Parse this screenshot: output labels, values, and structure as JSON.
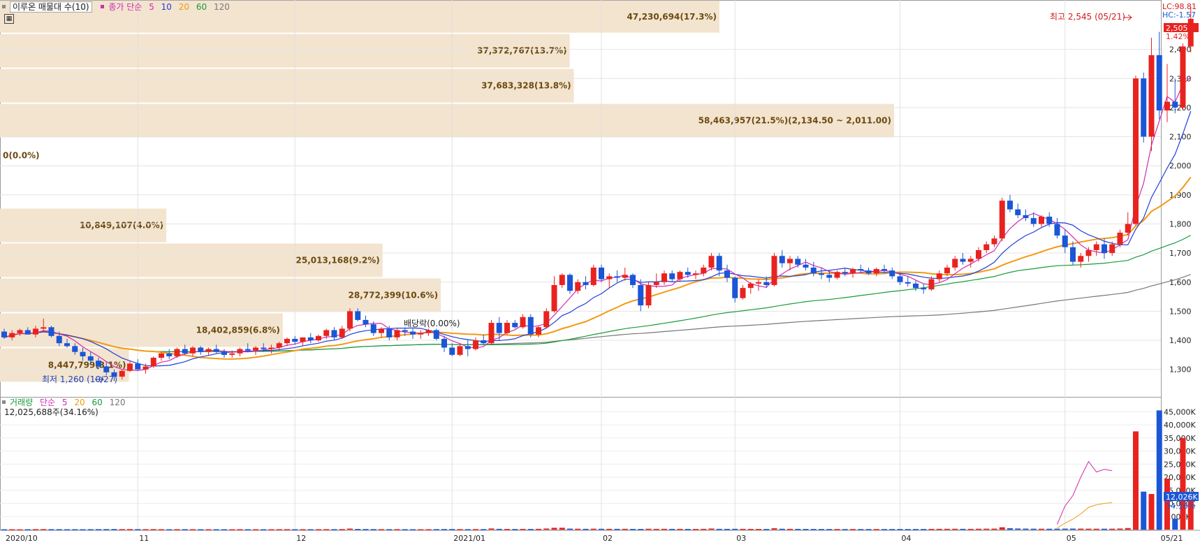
{
  "window": {
    "title": "이루온 매물대 수(10)"
  },
  "indicators": {
    "price": [
      {
        "label": "종가 단순",
        "color": "#d12bb0"
      },
      {
        "label": "5",
        "color": "#d12bb0"
      },
      {
        "label": "10",
        "color": "#1f3fd6"
      },
      {
        "label": "20",
        "color": "#f29a12"
      },
      {
        "label": "60",
        "color": "#1a9a3a"
      },
      {
        "label": "120",
        "color": "#777777"
      }
    ],
    "volume": [
      {
        "label": "거래량",
        "color": "#1a9a3a"
      },
      {
        "label": "단순",
        "color": "#d12bb0"
      },
      {
        "label": "5",
        "color": "#d12bb0"
      },
      {
        "label": "20",
        "color": "#f29a12"
      },
      {
        "label": "60",
        "color": "#1a9a3a"
      },
      {
        "label": "120",
        "color": "#777777"
      }
    ],
    "volume_readout": "12,025,688주(34.16%)"
  },
  "colors": {
    "up": "#e8231f",
    "down": "#1a56d6",
    "band": "#f3e4cf",
    "band_text": "#6b4a12",
    "ma5": "#d12bb0",
    "ma10": "#1f3fd6",
    "ma20": "#f29a12",
    "ma60": "#1a9a3a",
    "ma120": "#777777"
  },
  "side_readout": {
    "lc": "LC:98.81",
    "hc": "HC:-1.57",
    "current_price": "2,505",
    "current_pct": "1.42%",
    "current_volume": "12,026K",
    "volume_pct": "34.16%"
  },
  "annotations": {
    "high": "최고 2,545 (05/21)",
    "low": "최저 1,260 (10/27)",
    "dividend": "배당락(0.00%)"
  },
  "chart_data": {
    "type": "candlestick",
    "price_axis": {
      "min": 1220,
      "max": 2560,
      "ticks": [
        1300,
        1400,
        1500,
        1600,
        1700,
        1800,
        1900,
        2000,
        2100,
        2200,
        2300,
        2400
      ],
      "tick_labels": [
        "1,300",
        "1,400",
        "1,500",
        "1,600",
        "1,700",
        "1,800",
        "1,900",
        "2,000",
        "2,100",
        "2,200",
        "2,300",
        "2,400"
      ]
    },
    "volume_axis": {
      "max": 48000,
      "ticks": [
        5000,
        10000,
        15000,
        20000,
        25000,
        30000,
        35000,
        40000,
        45000
      ],
      "tick_labels": [
        "5,000K",
        "10,000K",
        "15,000K",
        "20,000K",
        "25,000K",
        "30,000K",
        "35,000K",
        "40,000K",
        "45,000K"
      ]
    },
    "x_labels": [
      {
        "label": "2020/10",
        "bar": 0
      },
      {
        "label": "11",
        "bar": 17
      },
      {
        "label": "12",
        "bar": 37
      },
      {
        "label": "2021/01",
        "bar": 57
      },
      {
        "label": "02",
        "bar": 76
      },
      {
        "label": "03",
        "bar": 93
      },
      {
        "label": "04",
        "bar": 114
      },
      {
        "label": "05",
        "bar": 135
      },
      {
        "label": "05/21",
        "bar": 147
      }
    ],
    "volume_profile": [
      {
        "price_lo": 2455,
        "price_hi": 2570,
        "pct": 17.3,
        "label": "47,230,694(17.3%)"
      },
      {
        "price_lo": 2335,
        "price_hi": 2455,
        "pct": 13.7,
        "label": "37,372,767(13.7%)"
      },
      {
        "price_lo": 2215,
        "price_hi": 2335,
        "pct": 13.8,
        "label": "37,683,328(13.8%)"
      },
      {
        "price_lo": 2095,
        "price_hi": 2215,
        "pct": 21.5,
        "label": "58,463,957(21.5%)(2,134.50 ~ 2,011.00)"
      },
      {
        "price_lo": 1975,
        "price_hi": 2095,
        "pct": 0.0,
        "label": "0(0.0%)"
      },
      {
        "price_lo": 1855,
        "price_hi": 1975,
        "pct": 0.0,
        "label": ""
      },
      {
        "price_lo": 1735,
        "price_hi": 1855,
        "pct": 4.0,
        "label": "10,849,107(4.0%)"
      },
      {
        "price_lo": 1615,
        "price_hi": 1735,
        "pct": 9.2,
        "label": "25,013,168(9.2%)"
      },
      {
        "price_lo": 1495,
        "price_hi": 1615,
        "pct": 10.6,
        "label": "28,772,399(10.6%)"
      },
      {
        "price_lo": 1375,
        "price_hi": 1495,
        "pct": 6.8,
        "label": "18,402,859(6.8%)"
      },
      {
        "price_lo": 1255,
        "price_hi": 1375,
        "pct": 3.1,
        "label": "8,447,799(3.1%)"
      }
    ],
    "candles": [
      [
        1430,
        1440,
        1405,
        1410,
        120
      ],
      [
        1410,
        1435,
        1400,
        1425,
        130
      ],
      [
        1425,
        1440,
        1415,
        1435,
        110
      ],
      [
        1435,
        1445,
        1420,
        1420,
        140
      ],
      [
        1420,
        1450,
        1410,
        1440,
        180
      ],
      [
        1440,
        1475,
        1430,
        1445,
        200
      ],
      [
        1445,
        1450,
        1410,
        1415,
        170
      ],
      [
        1415,
        1430,
        1380,
        1390,
        160
      ],
      [
        1390,
        1405,
        1375,
        1380,
        130
      ],
      [
        1380,
        1390,
        1350,
        1360,
        150
      ],
      [
        1360,
        1375,
        1330,
        1345,
        140
      ],
      [
        1345,
        1360,
        1320,
        1330,
        170
      ],
      [
        1330,
        1340,
        1300,
        1310,
        180
      ],
      [
        1310,
        1325,
        1280,
        1290,
        200
      ],
      [
        1290,
        1300,
        1260,
        1275,
        230
      ],
      [
        1275,
        1300,
        1265,
        1295,
        190
      ],
      [
        1295,
        1330,
        1290,
        1320,
        210
      ],
      [
        1320,
        1335,
        1295,
        1300,
        180
      ],
      [
        1300,
        1320,
        1285,
        1310,
        170
      ],
      [
        1310,
        1345,
        1305,
        1340,
        190
      ],
      [
        1340,
        1360,
        1330,
        1355,
        160
      ],
      [
        1355,
        1370,
        1335,
        1345,
        150
      ],
      [
        1345,
        1375,
        1340,
        1370,
        170
      ],
      [
        1370,
        1385,
        1350,
        1355,
        160
      ],
      [
        1355,
        1380,
        1345,
        1375,
        150
      ],
      [
        1375,
        1380,
        1350,
        1360,
        140
      ],
      [
        1360,
        1375,
        1350,
        1370,
        130
      ],
      [
        1370,
        1385,
        1355,
        1360,
        150
      ],
      [
        1360,
        1370,
        1340,
        1350,
        140
      ],
      [
        1350,
        1365,
        1340,
        1355,
        130
      ],
      [
        1355,
        1375,
        1345,
        1370,
        160
      ],
      [
        1370,
        1390,
        1360,
        1365,
        150
      ],
      [
        1365,
        1380,
        1350,
        1375,
        140
      ],
      [
        1375,
        1390,
        1360,
        1370,
        130
      ],
      [
        1370,
        1385,
        1355,
        1375,
        140
      ],
      [
        1375,
        1395,
        1365,
        1390,
        160
      ],
      [
        1390,
        1410,
        1380,
        1405,
        170
      ],
      [
        1405,
        1415,
        1385,
        1395,
        150
      ],
      [
        1395,
        1410,
        1380,
        1410,
        160
      ],
      [
        1410,
        1425,
        1390,
        1400,
        150
      ],
      [
        1400,
        1420,
        1395,
        1415,
        160
      ],
      [
        1415,
        1440,
        1405,
        1435,
        180
      ],
      [
        1435,
        1445,
        1400,
        1410,
        170
      ],
      [
        1410,
        1450,
        1405,
        1440,
        210
      ],
      [
        1440,
        1510,
        1430,
        1500,
        400
      ],
      [
        1500,
        1510,
        1465,
        1470,
        260
      ],
      [
        1470,
        1485,
        1445,
        1455,
        230
      ],
      [
        1455,
        1465,
        1415,
        1425,
        200
      ],
      [
        1425,
        1445,
        1410,
        1440,
        180
      ],
      [
        1440,
        1450,
        1400,
        1410,
        170
      ],
      [
        1410,
        1440,
        1400,
        1435,
        180
      ],
      [
        1435,
        1445,
        1415,
        1430,
        160
      ],
      [
        1430,
        1440,
        1405,
        1420,
        150
      ],
      [
        1420,
        1435,
        1405,
        1425,
        140
      ],
      [
        1425,
        1440,
        1415,
        1435,
        150
      ],
      [
        1435,
        1440,
        1400,
        1405,
        190
      ],
      [
        1405,
        1415,
        1360,
        1375,
        220
      ],
      [
        1375,
        1390,
        1345,
        1350,
        230
      ],
      [
        1350,
        1385,
        1345,
        1380,
        200
      ],
      [
        1380,
        1400,
        1345,
        1370,
        180
      ],
      [
        1370,
        1410,
        1365,
        1400,
        210
      ],
      [
        1400,
        1420,
        1385,
        1390,
        190
      ],
      [
        1390,
        1470,
        1385,
        1460,
        440
      ],
      [
        1460,
        1480,
        1400,
        1425,
        300
      ],
      [
        1425,
        1470,
        1420,
        1460,
        260
      ],
      [
        1460,
        1470,
        1440,
        1445,
        230
      ],
      [
        1445,
        1490,
        1440,
        1480,
        280
      ],
      [
        1480,
        1490,
        1410,
        1420,
        260
      ],
      [
        1420,
        1450,
        1410,
        1445,
        300
      ],
      [
        1445,
        1510,
        1440,
        1500,
        420
      ],
      [
        1500,
        1620,
        1495,
        1590,
        700
      ],
      [
        1590,
        1630,
        1580,
        1625,
        720
      ],
      [
        1625,
        1630,
        1560,
        1570,
        380
      ],
      [
        1570,
        1610,
        1560,
        1600,
        340
      ],
      [
        1600,
        1620,
        1575,
        1590,
        300
      ],
      [
        1590,
        1660,
        1585,
        1650,
        360
      ],
      [
        1650,
        1660,
        1600,
        1610,
        320
      ],
      [
        1610,
        1630,
        1580,
        1620,
        300
      ],
      [
        1620,
        1640,
        1600,
        1615,
        290
      ],
      [
        1615,
        1650,
        1605,
        1625,
        310
      ],
      [
        1625,
        1630,
        1580,
        1590,
        270
      ],
      [
        1590,
        1610,
        1500,
        1520,
        260
      ],
      [
        1520,
        1600,
        1510,
        1590,
        330
      ],
      [
        1590,
        1630,
        1580,
        1600,
        290
      ],
      [
        1600,
        1640,
        1590,
        1630,
        310
      ],
      [
        1630,
        1640,
        1600,
        1610,
        280
      ],
      [
        1610,
        1640,
        1600,
        1635,
        290
      ],
      [
        1635,
        1650,
        1615,
        1625,
        270
      ],
      [
        1625,
        1640,
        1610,
        1630,
        260
      ],
      [
        1630,
        1660,
        1620,
        1650,
        300
      ],
      [
        1650,
        1700,
        1640,
        1690,
        420
      ],
      [
        1690,
        1700,
        1620,
        1640,
        300
      ],
      [
        1640,
        1660,
        1600,
        1615,
        280
      ],
      [
        1615,
        1620,
        1530,
        1545,
        310
      ],
      [
        1545,
        1590,
        1540,
        1580,
        290
      ],
      [
        1580,
        1600,
        1560,
        1595,
        270
      ],
      [
        1595,
        1610,
        1570,
        1600,
        260
      ],
      [
        1600,
        1620,
        1580,
        1590,
        250
      ],
      [
        1590,
        1700,
        1585,
        1690,
        520
      ],
      [
        1690,
        1710,
        1650,
        1665,
        330
      ],
      [
        1665,
        1690,
        1640,
        1680,
        300
      ],
      [
        1680,
        1690,
        1650,
        1660,
        280
      ],
      [
        1660,
        1680,
        1640,
        1650,
        260
      ],
      [
        1650,
        1670,
        1620,
        1630,
        250
      ],
      [
        1630,
        1650,
        1610,
        1625,
        240
      ],
      [
        1625,
        1640,
        1600,
        1615,
        230
      ],
      [
        1615,
        1640,
        1610,
        1635,
        240
      ],
      [
        1635,
        1650,
        1620,
        1630,
        220
      ],
      [
        1630,
        1650,
        1615,
        1645,
        230
      ],
      [
        1645,
        1660,
        1630,
        1640,
        220
      ],
      [
        1640,
        1650,
        1625,
        1630,
        210
      ],
      [
        1630,
        1650,
        1620,
        1645,
        220
      ],
      [
        1645,
        1660,
        1630,
        1640,
        210
      ],
      [
        1640,
        1650,
        1610,
        1620,
        230
      ],
      [
        1620,
        1630,
        1590,
        1600,
        240
      ],
      [
        1600,
        1620,
        1585,
        1595,
        220
      ],
      [
        1595,
        1605,
        1570,
        1580,
        230
      ],
      [
        1580,
        1595,
        1560,
        1575,
        250
      ],
      [
        1575,
        1620,
        1570,
        1610,
        280
      ],
      [
        1610,
        1640,
        1600,
        1630,
        300
      ],
      [
        1630,
        1660,
        1620,
        1650,
        310
      ],
      [
        1650,
        1690,
        1640,
        1680,
        330
      ],
      [
        1680,
        1700,
        1660,
        1670,
        300
      ],
      [
        1670,
        1690,
        1650,
        1680,
        290
      ],
      [
        1680,
        1720,
        1670,
        1710,
        340
      ],
      [
        1710,
        1740,
        1700,
        1730,
        360
      ],
      [
        1730,
        1760,
        1720,
        1750,
        380
      ],
      [
        1750,
        1890,
        1740,
        1880,
        900
      ],
      [
        1880,
        1900,
        1840,
        1850,
        520
      ],
      [
        1850,
        1870,
        1820,
        1830,
        420
      ],
      [
        1830,
        1850,
        1810,
        1820,
        380
      ],
      [
        1820,
        1840,
        1790,
        1800,
        350
      ],
      [
        1800,
        1830,
        1790,
        1825,
        340
      ],
      [
        1825,
        1840,
        1790,
        1800,
        330
      ],
      [
        1800,
        1820,
        1750,
        1760,
        360
      ],
      [
        1760,
        1780,
        1700,
        1720,
        380
      ],
      [
        1720,
        1740,
        1660,
        1670,
        400
      ],
      [
        1670,
        1700,
        1650,
        1690,
        380
      ],
      [
        1690,
        1720,
        1670,
        1710,
        360
      ],
      [
        1710,
        1740,
        1690,
        1730,
        350
      ],
      [
        1730,
        1750,
        1680,
        1700,
        340
      ],
      [
        1700,
        1740,
        1690,
        1730,
        360
      ],
      [
        1730,
        1780,
        1720,
        1770,
        420
      ],
      [
        1770,
        1840,
        1760,
        1800,
        600
      ],
      [
        1800,
        2310,
        1795,
        2300,
        37500
      ],
      [
        2300,
        2320,
        2080,
        2100,
        14500
      ],
      [
        2100,
        2440,
        2050,
        2380,
        13600
      ],
      [
        2380,
        2460,
        2160,
        2190,
        45500
      ],
      [
        2190,
        2350,
        2150,
        2220,
        19500
      ],
      [
        2220,
        2300,
        2180,
        2200,
        4200
      ],
      [
        2200,
        2420,
        2190,
        2410,
        35000
      ],
      [
        2410,
        2545,
        2390,
        2505,
        12026
      ]
    ],
    "ma5_volume": [
      [
        134,
        2000
      ],
      [
        135,
        9000
      ],
      [
        136,
        13000
      ],
      [
        137,
        20000
      ],
      [
        138,
        26000
      ],
      [
        139,
        22000
      ],
      [
        140,
        23000
      ],
      [
        141,
        22500
      ]
    ],
    "ma20_volume": [
      [
        134,
        600
      ],
      [
        135,
        2500
      ],
      [
        136,
        4000
      ],
      [
        137,
        6000
      ],
      [
        138,
        8500
      ],
      [
        139,
        9500
      ],
      [
        140,
        10000
      ],
      [
        141,
        10300
      ]
    ]
  }
}
